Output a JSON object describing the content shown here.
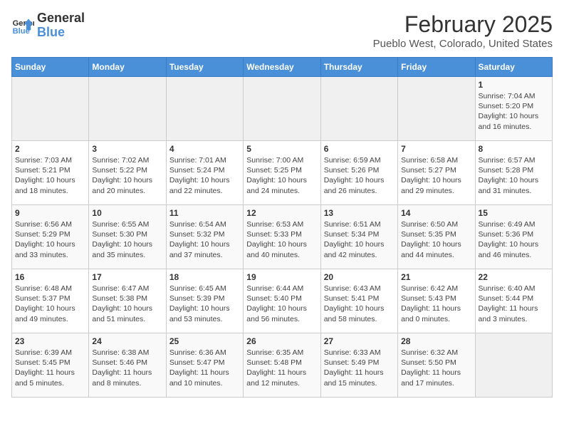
{
  "logo": {
    "line1": "General",
    "line2": "Blue"
  },
  "title": "February 2025",
  "subtitle": "Pueblo West, Colorado, United States",
  "days_of_week": [
    "Sunday",
    "Monday",
    "Tuesday",
    "Wednesday",
    "Thursday",
    "Friday",
    "Saturday"
  ],
  "weeks": [
    [
      {
        "day": "",
        "info": ""
      },
      {
        "day": "",
        "info": ""
      },
      {
        "day": "",
        "info": ""
      },
      {
        "day": "",
        "info": ""
      },
      {
        "day": "",
        "info": ""
      },
      {
        "day": "",
        "info": ""
      },
      {
        "day": "1",
        "info": "Sunrise: 7:04 AM\nSunset: 5:20 PM\nDaylight: 10 hours and 16 minutes."
      }
    ],
    [
      {
        "day": "2",
        "info": "Sunrise: 7:03 AM\nSunset: 5:21 PM\nDaylight: 10 hours and 18 minutes."
      },
      {
        "day": "3",
        "info": "Sunrise: 7:02 AM\nSunset: 5:22 PM\nDaylight: 10 hours and 20 minutes."
      },
      {
        "day": "4",
        "info": "Sunrise: 7:01 AM\nSunset: 5:24 PM\nDaylight: 10 hours and 22 minutes."
      },
      {
        "day": "5",
        "info": "Sunrise: 7:00 AM\nSunset: 5:25 PM\nDaylight: 10 hours and 24 minutes."
      },
      {
        "day": "6",
        "info": "Sunrise: 6:59 AM\nSunset: 5:26 PM\nDaylight: 10 hours and 26 minutes."
      },
      {
        "day": "7",
        "info": "Sunrise: 6:58 AM\nSunset: 5:27 PM\nDaylight: 10 hours and 29 minutes."
      },
      {
        "day": "8",
        "info": "Sunrise: 6:57 AM\nSunset: 5:28 PM\nDaylight: 10 hours and 31 minutes."
      }
    ],
    [
      {
        "day": "9",
        "info": "Sunrise: 6:56 AM\nSunset: 5:29 PM\nDaylight: 10 hours and 33 minutes."
      },
      {
        "day": "10",
        "info": "Sunrise: 6:55 AM\nSunset: 5:30 PM\nDaylight: 10 hours and 35 minutes."
      },
      {
        "day": "11",
        "info": "Sunrise: 6:54 AM\nSunset: 5:32 PM\nDaylight: 10 hours and 37 minutes."
      },
      {
        "day": "12",
        "info": "Sunrise: 6:53 AM\nSunset: 5:33 PM\nDaylight: 10 hours and 40 minutes."
      },
      {
        "day": "13",
        "info": "Sunrise: 6:51 AM\nSunset: 5:34 PM\nDaylight: 10 hours and 42 minutes."
      },
      {
        "day": "14",
        "info": "Sunrise: 6:50 AM\nSunset: 5:35 PM\nDaylight: 10 hours and 44 minutes."
      },
      {
        "day": "15",
        "info": "Sunrise: 6:49 AM\nSunset: 5:36 PM\nDaylight: 10 hours and 46 minutes."
      }
    ],
    [
      {
        "day": "16",
        "info": "Sunrise: 6:48 AM\nSunset: 5:37 PM\nDaylight: 10 hours and 49 minutes."
      },
      {
        "day": "17",
        "info": "Sunrise: 6:47 AM\nSunset: 5:38 PM\nDaylight: 10 hours and 51 minutes."
      },
      {
        "day": "18",
        "info": "Sunrise: 6:45 AM\nSunset: 5:39 PM\nDaylight: 10 hours and 53 minutes."
      },
      {
        "day": "19",
        "info": "Sunrise: 6:44 AM\nSunset: 5:40 PM\nDaylight: 10 hours and 56 minutes."
      },
      {
        "day": "20",
        "info": "Sunrise: 6:43 AM\nSunset: 5:41 PM\nDaylight: 10 hours and 58 minutes."
      },
      {
        "day": "21",
        "info": "Sunrise: 6:42 AM\nSunset: 5:43 PM\nDaylight: 11 hours and 0 minutes."
      },
      {
        "day": "22",
        "info": "Sunrise: 6:40 AM\nSunset: 5:44 PM\nDaylight: 11 hours and 3 minutes."
      }
    ],
    [
      {
        "day": "23",
        "info": "Sunrise: 6:39 AM\nSunset: 5:45 PM\nDaylight: 11 hours and 5 minutes."
      },
      {
        "day": "24",
        "info": "Sunrise: 6:38 AM\nSunset: 5:46 PM\nDaylight: 11 hours and 8 minutes."
      },
      {
        "day": "25",
        "info": "Sunrise: 6:36 AM\nSunset: 5:47 PM\nDaylight: 11 hours and 10 minutes."
      },
      {
        "day": "26",
        "info": "Sunrise: 6:35 AM\nSunset: 5:48 PM\nDaylight: 11 hours and 12 minutes."
      },
      {
        "day": "27",
        "info": "Sunrise: 6:33 AM\nSunset: 5:49 PM\nDaylight: 11 hours and 15 minutes."
      },
      {
        "day": "28",
        "info": "Sunrise: 6:32 AM\nSunset: 5:50 PM\nDaylight: 11 hours and 17 minutes."
      },
      {
        "day": "",
        "info": ""
      }
    ]
  ]
}
